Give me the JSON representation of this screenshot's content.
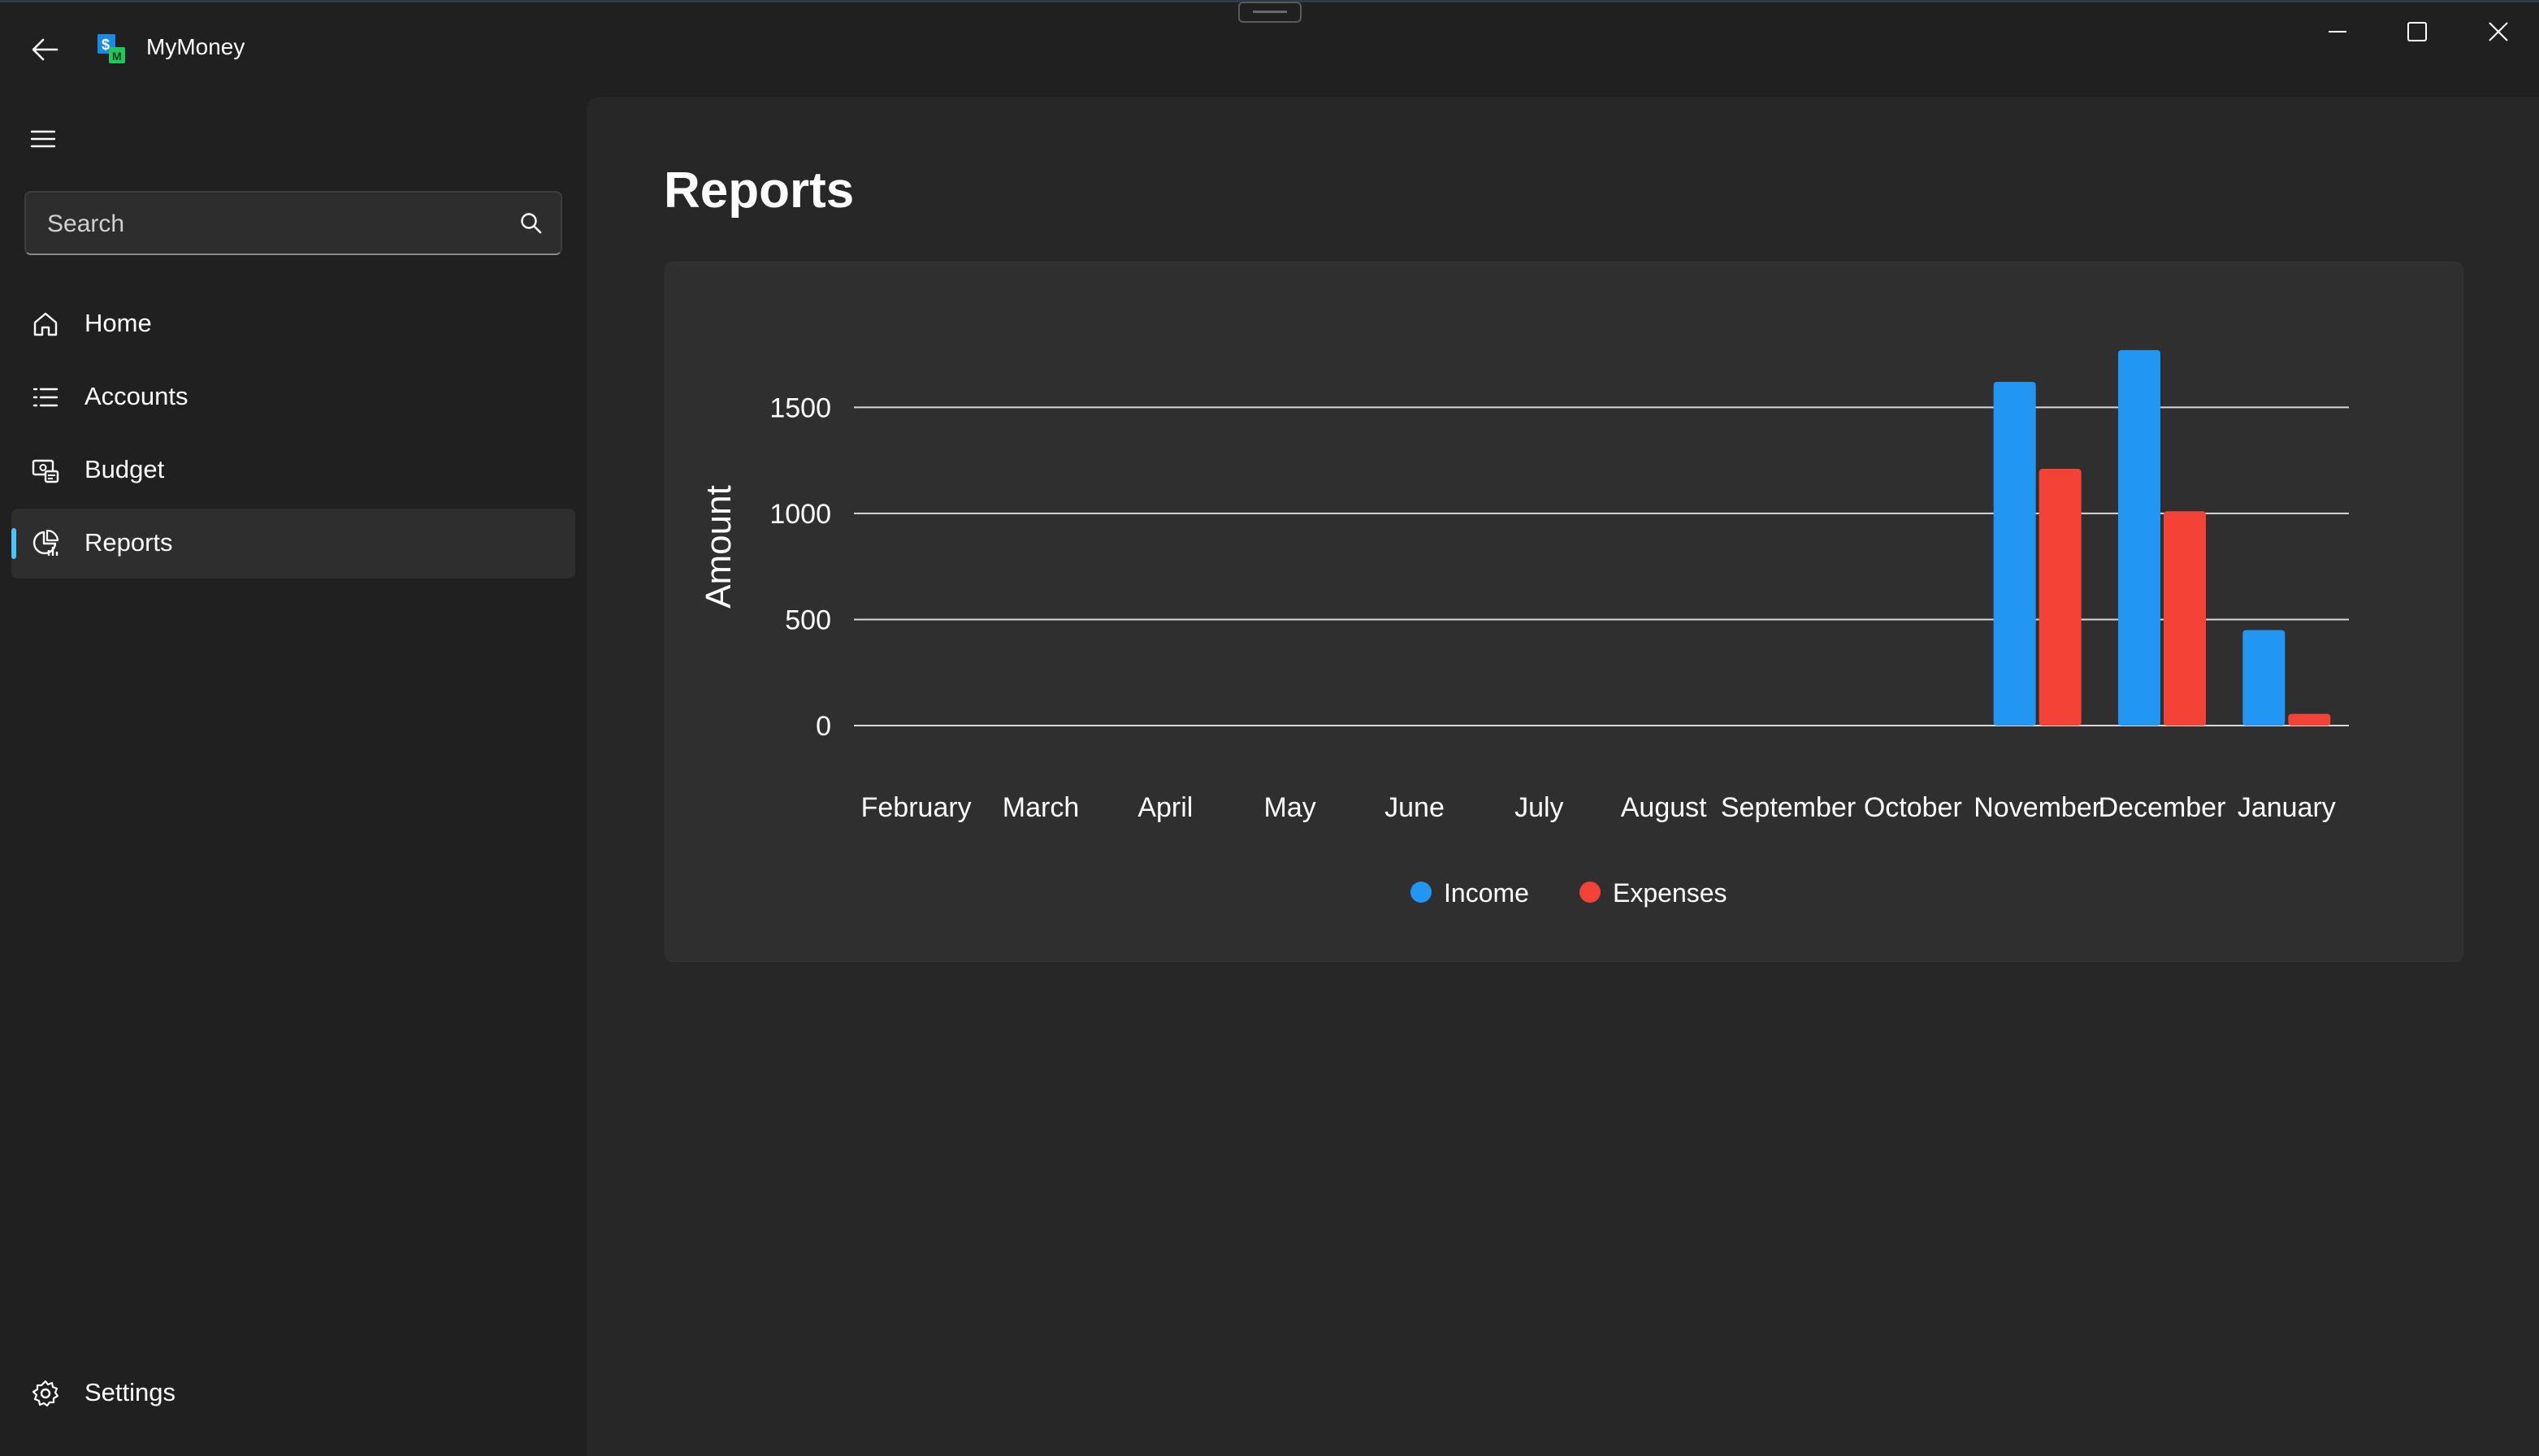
{
  "window": {
    "app_title": "MyMoney"
  },
  "nav": {
    "search_placeholder": "Search",
    "items": [
      {
        "label": "Home",
        "icon": "home-icon"
      },
      {
        "label": "Accounts",
        "icon": "list-icon"
      },
      {
        "label": "Budget",
        "icon": "budget-icon"
      },
      {
        "label": "Reports",
        "icon": "report-icon",
        "selected": true
      }
    ],
    "settings_label": "Settings"
  },
  "page": {
    "title": "Reports"
  },
  "colors": {
    "income": "#2196F3",
    "expenses": "#F44336",
    "accent": "#4cc2ff"
  },
  "chart_data": {
    "type": "bar",
    "categories": [
      "February",
      "March",
      "April",
      "May",
      "June",
      "July",
      "August",
      "September",
      "October",
      "November",
      "December",
      "January"
    ],
    "series": [
      {
        "name": "Income",
        "values": [
          0,
          0,
          0,
          0,
          0,
          0,
          0,
          0,
          0,
          1620,
          1770,
          450
        ]
      },
      {
        "name": "Expenses",
        "values": [
          0,
          0,
          0,
          0,
          0,
          0,
          0,
          0,
          0,
          1210,
          1010,
          55
        ]
      }
    ],
    "ylabel": "Amount",
    "yticks": [
      0,
      500,
      1000,
      1500
    ],
    "ylim": [
      0,
      1800
    ],
    "grid": true,
    "legend": "bottom-center"
  }
}
